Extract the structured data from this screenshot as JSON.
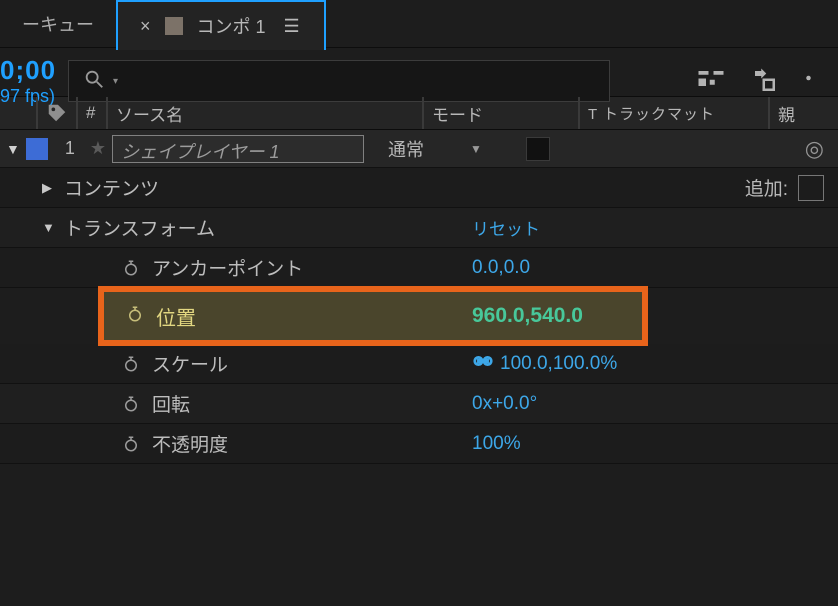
{
  "tabs": {
    "prev": "ーキュー",
    "active_name": "コンポ 1",
    "close": "×",
    "menu": "☰"
  },
  "timecode": {
    "tc": "0;00",
    "fps": "97 fps)"
  },
  "search": {
    "glyph": "⌕",
    "caret": "▾"
  },
  "columns": {
    "num": "#",
    "source": "ソース名",
    "mode": "モード",
    "track": "T  トラックマット",
    "parent": "親"
  },
  "layer": {
    "index": "1",
    "name": "シェイプレイヤー 1",
    "mode": "通常",
    "twist": "▼"
  },
  "props": {
    "contents": {
      "label": "コンテンツ",
      "arrow": "▶",
      "add": "追加:"
    },
    "transform": {
      "label": "トランスフォーム",
      "arrow": "▼",
      "reset": "リセット"
    },
    "anchor": {
      "label": "アンカーポイント",
      "value": "0.0,0.0"
    },
    "position": {
      "label": "位置",
      "value": "960.0,540.0"
    },
    "scale": {
      "label": "スケール",
      "value": "100.0,100.0%"
    },
    "rotation": {
      "label": "回転",
      "value": "0x+0.0°"
    },
    "opacity": {
      "label": "不透明度",
      "value": "100%"
    }
  }
}
